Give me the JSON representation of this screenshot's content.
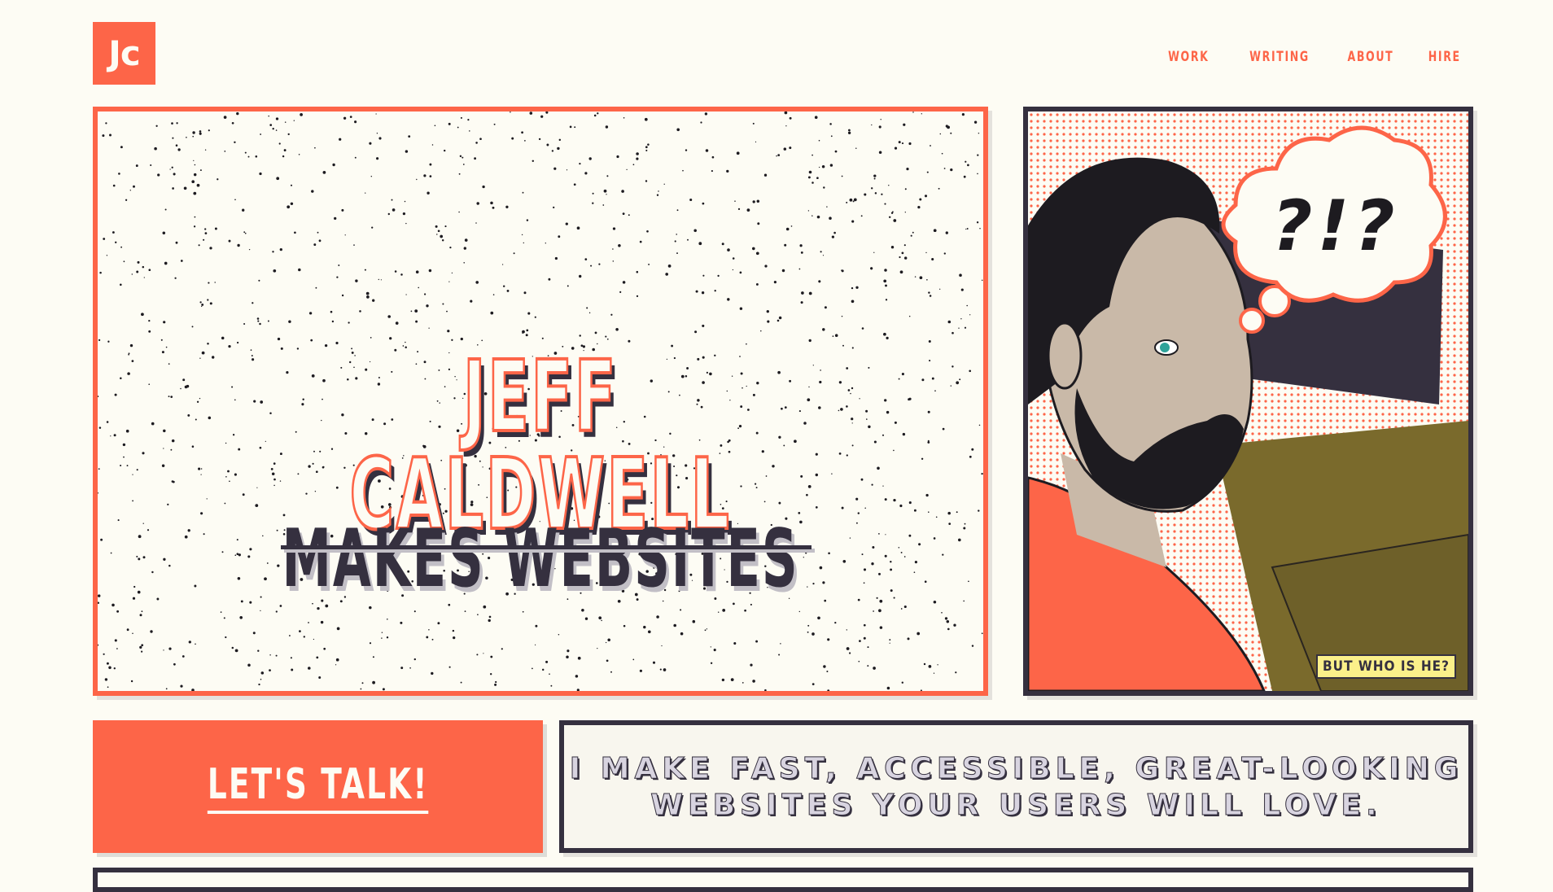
{
  "header": {
    "logo_text": "Jc",
    "nav": [
      {
        "label": "WORK"
      },
      {
        "label": "WRITING"
      },
      {
        "label": "ABOUT"
      },
      {
        "label": "HIRE"
      }
    ]
  },
  "hero": {
    "name": "JEFF CALDWELL",
    "tagline": "MAKES WEBSITES"
  },
  "portrait": {
    "thought_text": "?!?",
    "badge": "BUT WHO IS HE?"
  },
  "cta": {
    "label": "LET'S TALK!"
  },
  "pitch": {
    "text": "I make fast, accessible, great-looking websites your users will love."
  },
  "colors": {
    "accent": "#fd6548",
    "dark": "#35303f",
    "background": "#fdfcf4",
    "badge": "#fbf08a"
  }
}
